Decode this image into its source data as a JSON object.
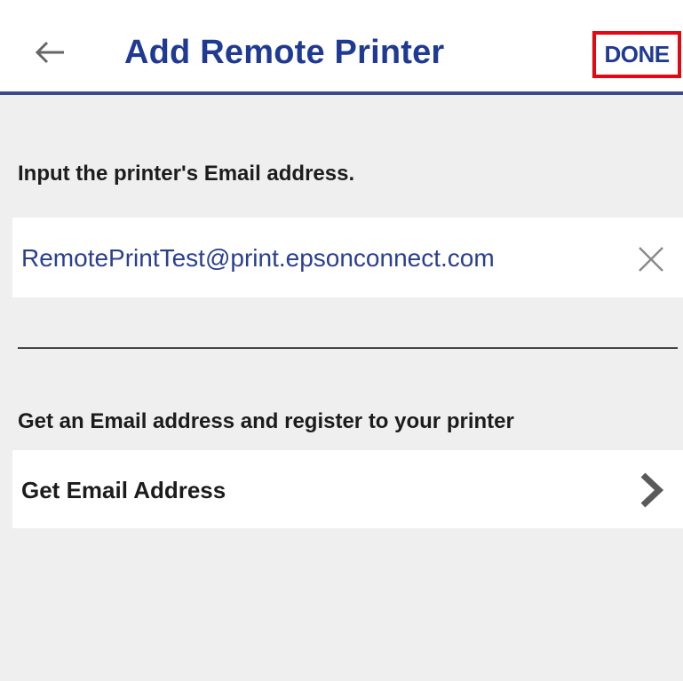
{
  "header": {
    "back_icon": "arrow-left-icon",
    "title": "Add Remote Printer",
    "done_label": "DONE",
    "accent_color": "#1f3a93",
    "highlight_color": "#e30613"
  },
  "email_section": {
    "label": "Input the printer's Email address.",
    "value": "RemotePrintTest@print.epsonconnect.com",
    "clear_icon": "close-icon"
  },
  "register_section": {
    "label": "Get an Email address and register to your printer",
    "link_label": "Get Email Address",
    "link_icon": "chevron-right-icon"
  }
}
